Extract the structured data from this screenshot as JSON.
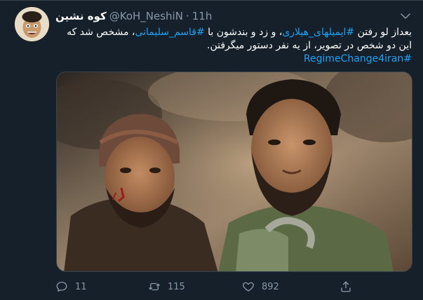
{
  "tweet": {
    "author_name": "کوه نشین",
    "author_handle": "@KoH_NeshiN",
    "separator": "·",
    "time": "11h",
    "text_line1_part1": "بعداز لو رفتن ",
    "hashtag1": "#ایمیلهای_هیلاری",
    "text_line1_part2": "، و زد و بندشون با ",
    "hashtag2": "#قاسم_سلیمانی",
    "text_line1_part3": "، مشخص شد که",
    "text_line2": "این دو شخص در تصویر، از یه نفر دستور میگرفتن.",
    "hashtag3": "#RegimeChange4iran",
    "reply_count": "11",
    "retweet_count": "115",
    "like_count": "892"
  },
  "icons": {
    "caret": "chevron-down-icon",
    "reply": "reply-icon",
    "retweet": "retweet-icon",
    "like": "heart-icon",
    "share": "share-icon"
  },
  "colors": {
    "background": "#15202b",
    "text": "#ffffff",
    "muted": "#8899a6",
    "link": "#1da1f2",
    "border": "#38444d"
  }
}
